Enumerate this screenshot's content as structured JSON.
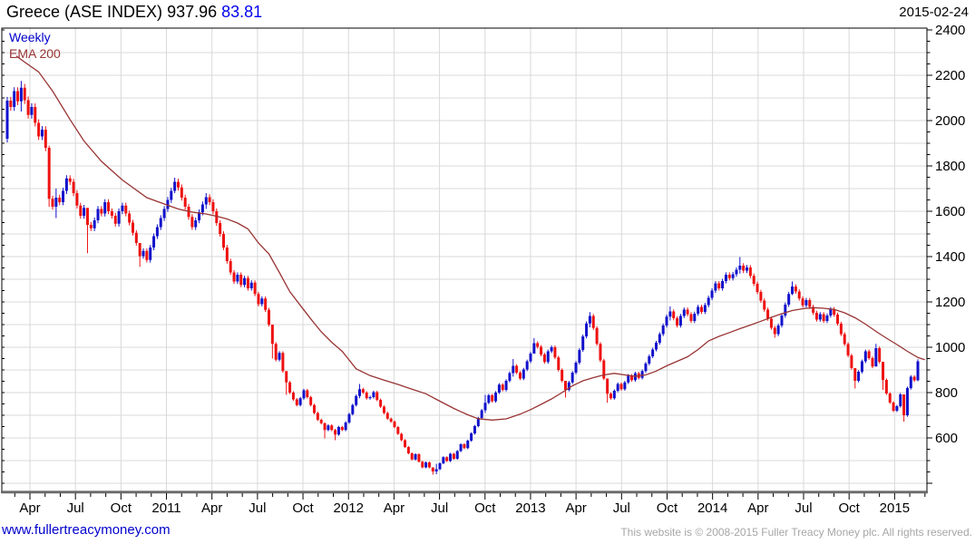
{
  "header": {
    "title": "Greece (ASE INDEX)",
    "last_price": "937.96",
    "change": "83.81",
    "date": "2015-02-24"
  },
  "legend": {
    "series_label": "Weekly",
    "overlay_label": "EMA 200"
  },
  "footer": {
    "link": "www.fullertreacymoney.com",
    "copyright": "This website is © 2008-2015 Fuller Treacy Money plc. All rights reserved."
  },
  "colors": {
    "up_candle": "#1111cc",
    "down_candle": "#ee1111",
    "ema_line": "#993333",
    "grid": "#d9d9d9",
    "frame": "#000000",
    "bottom_axis": "#6b6b6b",
    "axis_text": "#000000",
    "change_text": "#0000ee",
    "link_text": "#0000cc",
    "copyright_text": "#a6a6a6"
  },
  "chart_data": {
    "type": "candlestick",
    "title": "Greece (ASE INDEX) weekly with 200-period EMA",
    "timeframe": "Weekly",
    "last_close": 937.96,
    "weekly_change": 83.81,
    "y_axis": {
      "min": 364,
      "max": 2408,
      "tick_step": 50,
      "grid_step": 100,
      "label_step": 200,
      "labels": [
        600,
        800,
        1000,
        1200,
        1400,
        1600,
        1800,
        2000,
        2200,
        2400
      ]
    },
    "x_axis": {
      "first_quarter_week": 6.5,
      "weeks_per_quarter": 13.044,
      "weeks_per_month": 4.348,
      "labels": [
        "Apr",
        "Jul",
        "Oct",
        "2011",
        "Apr",
        "Jul",
        "Oct",
        "2012",
        "Apr",
        "Jul",
        "Oct",
        "2013",
        "Apr",
        "Jul",
        "Oct",
        "2014",
        "Apr",
        "Jul",
        "Oct",
        "2015"
      ]
    },
    "first_open": 1920,
    "closes": [
      2088,
      2060,
      2130,
      2085,
      [
        2145,
        2175,
        2040
      ],
      2090,
      2025,
      2060,
      1990,
      1930,
      1960,
      1880,
      [
        1655,
        1890,
        1620
      ],
      1620,
      [
        1660,
        1700,
        1570
      ],
      1640,
      1690,
      1745,
      1730,
      1680,
      1625,
      1580,
      1615,
      [
        1540,
        1580,
        1415
      ],
      1525,
      1560,
      1610,
      1590,
      1640,
      1600,
      1580,
      1545,
      1600,
      1625,
      1590,
      1550,
      1505,
      1460,
      [
        1402,
        1450,
        1355
      ],
      1425,
      1385,
      1440,
      1490,
      1530,
      1570,
      1610,
      1650,
      1690,
      [
        1730,
        1748,
        1680
      ],
      1705,
      1660,
      1620,
      1575,
      1530,
      1560,
      1595,
      1630,
      [
        1662,
        1680,
        1610
      ],
      1640,
      1600,
      1548,
      1500,
      1440,
      1380,
      1330,
      1290,
      1320,
      1275,
      1305,
      1260,
      1285,
      1235,
      1190,
      1215,
      1165,
      1100,
      [
        1015,
        1060,
        950
      ],
      945,
      975,
      895,
      [
        845,
        885,
        790
      ],
      800,
      770,
      745,
      775,
      810,
      780,
      745,
      710,
      680,
      665,
      [
        635,
        668,
        598
      ],
      655,
      635,
      [
        615,
        640,
        590
      ],
      648,
      635,
      668,
      705,
      745,
      785,
      [
        815,
        838,
        775
      ],
      800,
      775,
      780,
      802,
      768,
      738,
      710,
      685,
      672,
      648,
      618,
      590,
      560,
      532,
      505,
      528,
      495,
      470,
      492,
      470,
      [
        452,
        470,
        438
      ],
      [
        462,
        486,
        440
      ],
      488,
      515,
      498,
      530,
      508,
      542,
      572,
      555,
      588,
      620,
      652,
      688,
      722,
      [
        755,
        790,
        710
      ],
      788,
      762,
      800,
      835,
      812,
      852,
      886,
      [
        918,
        948,
        870
      ],
      888,
      862,
      902,
      938,
      972,
      [
        1018,
        1040,
        980
      ],
      1002,
      968,
      935,
      982,
      1000,
      955,
      900,
      852,
      [
        812,
        832,
        778
      ],
      845,
      888,
      932,
      988,
      1048,
      1105,
      [
        1138,
        1155,
        1088
      ],
      1085,
      1015,
      942,
      862,
      [
        795,
        832,
        755
      ],
      775,
      808,
      838,
      815,
      845,
      875,
      855,
      885,
      865,
      895,
      928,
      960,
      990,
      1020,
      1058,
      1096,
      1135,
      [
        1158,
        1180,
        1118
      ],
      1128,
      1096,
      1138,
      1166,
      1146,
      1116,
      1148,
      1178,
      1156,
      1186,
      1218,
      1250,
      1282,
      1260,
      1292,
      1320,
      1305,
      1322,
      1342,
      [
        1360,
        1398,
        1325
      ],
      1338,
      1352,
      1315,
      1280,
      1244,
      1206,
      1166,
      1126,
      1086,
      [
        1058,
        1094,
        1042
      ],
      1096,
      1140,
      1188,
      1235,
      [
        1268,
        1290,
        1230
      ],
      1246,
      1215,
      1185,
      1208,
      1178,
      1152,
      1122,
      1146,
      1116,
      1140,
      1168,
      1144,
      1104,
      1058,
      1014,
      964,
      908,
      [
        852,
        890,
        818
      ],
      892,
      938,
      982,
      952,
      915,
      [
        996,
        1015,
        940
      ],
      936,
      [
        856,
        912,
        812
      ],
      796,
      756,
      720,
      740,
      792,
      [
        700,
        790,
        672
      ],
      820,
      870,
      854,
      [
        938,
        947,
        850
      ]
    ],
    "ema": [
      [
        2.6,
        2285
      ],
      [
        5,
        2258
      ],
      [
        9,
        2215
      ],
      [
        13,
        2130
      ],
      [
        18,
        2005
      ],
      [
        22,
        1910
      ],
      [
        27,
        1820
      ],
      [
        33,
        1738
      ],
      [
        40,
        1660
      ],
      [
        45,
        1632
      ],
      [
        49,
        1610
      ],
      [
        53,
        1596
      ],
      [
        57,
        1588
      ],
      [
        60,
        1578
      ],
      [
        63,
        1566
      ],
      [
        66,
        1548
      ],
      [
        69,
        1522
      ],
      [
        72,
        1460
      ],
      [
        75,
        1412
      ],
      [
        78,
        1330
      ],
      [
        81,
        1245
      ],
      [
        84,
        1185
      ],
      [
        87,
        1125
      ],
      [
        90,
        1068
      ],
      [
        93,
        1022
      ],
      [
        96,
        982
      ],
      [
        100,
        905
      ],
      [
        104,
        875
      ],
      [
        108,
        855
      ],
      [
        112,
        836
      ],
      [
        116,
        815
      ],
      [
        120,
        795
      ],
      [
        124,
        762
      ],
      [
        128,
        730
      ],
      [
        132,
        702
      ],
      [
        135,
        685
      ],
      [
        139,
        679
      ],
      [
        143,
        684
      ],
      [
        147,
        705
      ],
      [
        150,
        725
      ],
      [
        153,
        748
      ],
      [
        156,
        772
      ],
      [
        159,
        800
      ],
      [
        162,
        830
      ],
      [
        165,
        852
      ],
      [
        168,
        866
      ],
      [
        171,
        878
      ],
      [
        174,
        885
      ],
      [
        177,
        878
      ],
      [
        180,
        872
      ],
      [
        183,
        878
      ],
      [
        186,
        895
      ],
      [
        189,
        918
      ],
      [
        192,
        938
      ],
      [
        195,
        958
      ],
      [
        198,
        990
      ],
      [
        201,
        1028
      ],
      [
        204,
        1048
      ],
      [
        207,
        1065
      ],
      [
        210,
        1082
      ],
      [
        213,
        1098
      ],
      [
        216,
        1115
      ],
      [
        219,
        1132
      ],
      [
        222,
        1148
      ],
      [
        225,
        1162
      ],
      [
        228,
        1170
      ],
      [
        231,
        1175
      ],
      [
        234,
        1172
      ],
      [
        237,
        1167
      ],
      [
        240,
        1152
      ],
      [
        243,
        1130
      ],
      [
        246,
        1102
      ],
      [
        249,
        1070
      ],
      [
        252,
        1040
      ],
      [
        255,
        1012
      ],
      [
        258,
        982
      ],
      [
        261,
        955
      ],
      [
        263,
        945
      ]
    ]
  }
}
